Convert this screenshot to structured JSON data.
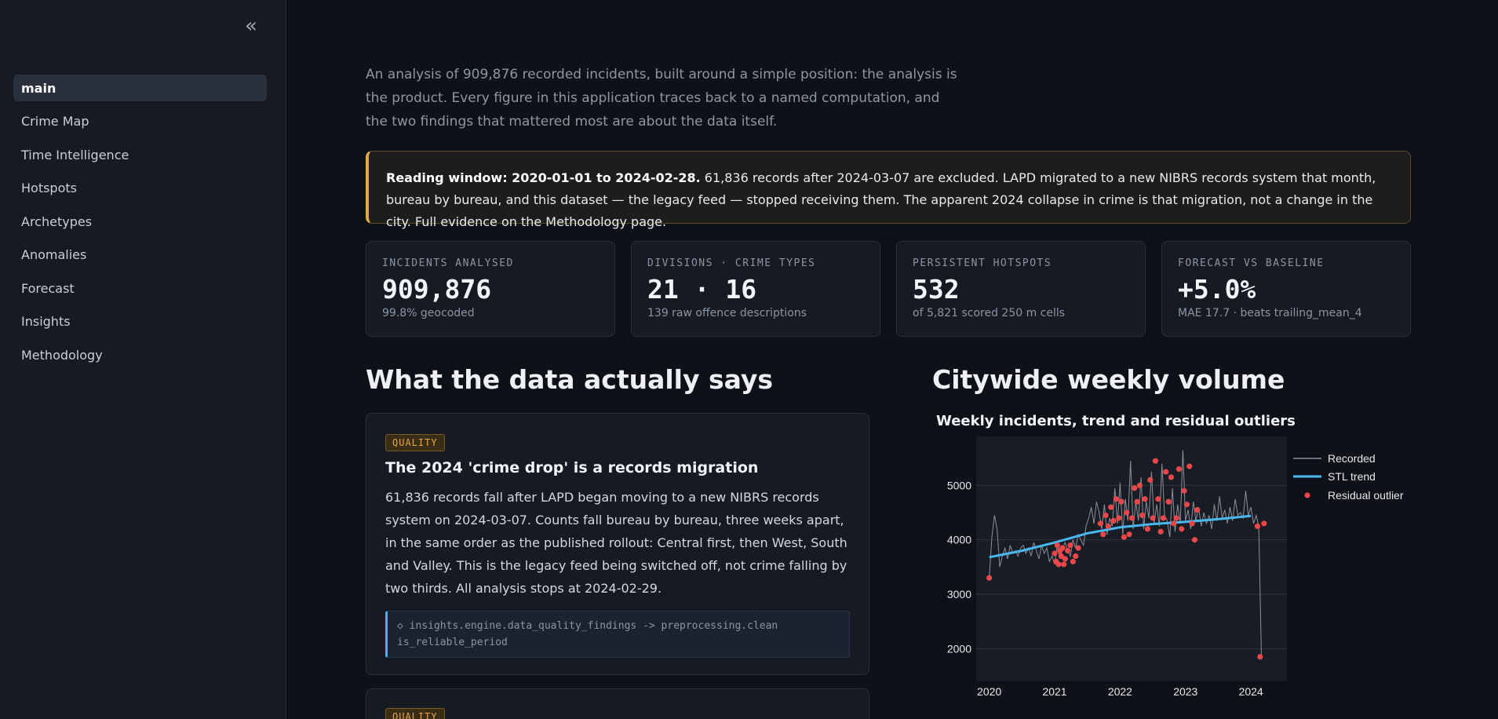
{
  "sidebar": {
    "collapse_icon": "«",
    "items": [
      {
        "label": "main",
        "active": true
      },
      {
        "label": "Crime Map"
      },
      {
        "label": "Time Intelligence"
      },
      {
        "label": "Hotspots"
      },
      {
        "label": "Archetypes"
      },
      {
        "label": "Anomalies"
      },
      {
        "label": "Forecast"
      },
      {
        "label": "Insights"
      },
      {
        "label": "Methodology"
      }
    ]
  },
  "intro": "An analysis of 909,876 recorded incidents, built around a simple position: the analysis is the product. Every figure in this application traces back to a named computation, and the two findings that mattered most are about the data itself.",
  "callout": {
    "bold": "Reading window: 2020-01-01 to 2024-02-28.",
    "text": " 61,836 records after 2024-03-07 are excluded. LAPD migrated to a new NIBRS records system that month, bureau by bureau, and this dataset — the legacy feed — stopped receiving them. The apparent 2024 collapse in crime is that migration, not a change in the city. Full evidence on the Methodology page."
  },
  "kpis": [
    {
      "label": "INCIDENTS ANALYSED",
      "value": "909,876",
      "sub": "99.8% geocoded"
    },
    {
      "label": "DIVISIONS · CRIME TYPES",
      "value": "21 · 16",
      "sub": "139 raw offence descriptions"
    },
    {
      "label": "PERSISTENT HOTSPOTS",
      "value": "532",
      "sub": "of 5,821 scored 250 m cells"
    },
    {
      "label": "FORECAST VS BASELINE",
      "value": "+5.0%",
      "sub": "MAE 17.7 · beats trailing_mean_4"
    }
  ],
  "findings": {
    "title": "What the data actually says",
    "cards": [
      {
        "tag": "QUALITY",
        "title": "The 2024 'crime drop' is a records migration",
        "body": "61,836 records fall after LAPD began moving to a new NIBRS records system on 2024-03-07. Counts fall bureau by bureau, three weeks apart, in the same order as the published rollout: Central first, then West, South and Valley. This is the legacy feed being switched off, not crime falling by two thirds. All analysis stops at 2024-02-29.",
        "code": "◇ insights.engine.data_quality_findings -> preprocessing.clean is_reliable_period"
      },
      {
        "tag": "QUALITY"
      }
    ]
  },
  "chart_section_title": "Citywide weekly volume",
  "colors": {
    "recorded": "#8a8f99",
    "trend": "#4ab8f0",
    "outlier": "#e8474a",
    "accent": "#e0a84a"
  },
  "chart_data": {
    "type": "line",
    "title": "Weekly incidents, trend and residual outliers",
    "xlabel": "",
    "ylabel": "",
    "xlim": [
      2019.8,
      2024.55
    ],
    "ylim": [
      1400,
      5900
    ],
    "xticks": [
      2020,
      2021,
      2022,
      2023,
      2024
    ],
    "yticks": [
      2000,
      3000,
      4000,
      5000
    ],
    "grid": true,
    "legend_position": "right",
    "series": [
      {
        "name": "Recorded",
        "x": [
          2020.0,
          2020.04,
          2020.08,
          2020.12,
          2020.16,
          2020.2,
          2020.24,
          2020.28,
          2020.32,
          2020.36,
          2020.4,
          2020.44,
          2020.48,
          2020.52,
          2020.56,
          2020.6,
          2020.64,
          2020.68,
          2020.72,
          2020.76,
          2020.8,
          2020.84,
          2020.88,
          2020.92,
          2020.96,
          2021.0,
          2021.04,
          2021.08,
          2021.12,
          2021.16,
          2021.2,
          2021.24,
          2021.28,
          2021.32,
          2021.36,
          2021.4,
          2021.44,
          2021.48,
          2021.52,
          2021.56,
          2021.6,
          2021.64,
          2021.68,
          2021.72,
          2021.76,
          2021.8,
          2021.84,
          2021.88,
          2021.92,
          2021.96,
          2022.0,
          2022.04,
          2022.08,
          2022.12,
          2022.16,
          2022.2,
          2022.24,
          2022.28,
          2022.32,
          2022.36,
          2022.4,
          2022.44,
          2022.48,
          2022.52,
          2022.56,
          2022.6,
          2022.64,
          2022.68,
          2022.72,
          2022.76,
          2022.8,
          2022.84,
          2022.88,
          2022.92,
          2022.96,
          2023.0,
          2023.04,
          2023.08,
          2023.12,
          2023.16,
          2023.2,
          2023.24,
          2023.28,
          2023.32,
          2023.36,
          2023.4,
          2023.44,
          2023.48,
          2023.52,
          2023.56,
          2023.6,
          2023.64,
          2023.68,
          2023.72,
          2023.76,
          2023.8,
          2023.84,
          2023.88,
          2023.92,
          2023.96,
          2024.0,
          2024.04,
          2024.08,
          2024.12,
          2024.16
        ],
        "y": [
          3300,
          4050,
          4450,
          4200,
          3500,
          3700,
          3850,
          3650,
          3900,
          3750,
          3800,
          3700,
          3850,
          3900,
          3750,
          3850,
          3700,
          3950,
          3800,
          3650,
          3900,
          3750,
          3850,
          3600,
          3700,
          3550,
          3900,
          3650,
          3850,
          3950,
          3800,
          3700,
          4000,
          3850,
          4100,
          4000,
          3900,
          4250,
          4400,
          4600,
          4300,
          4700,
          4500,
          4200,
          4650,
          4100,
          4400,
          4250,
          4950,
          4300,
          5050,
          4100,
          4750,
          4350,
          5450,
          4200,
          4700,
          4350,
          5150,
          4200,
          4700,
          4400,
          5250,
          4300,
          4650,
          4250,
          5400,
          4450,
          4350,
          4050,
          4950,
          4150,
          4650,
          4300,
          5650,
          4350,
          4550,
          4200,
          4700,
          4350,
          4600,
          4250,
          4500,
          4300,
          4450,
          4200,
          4650,
          4350,
          4800,
          4400,
          4550,
          4300,
          4600,
          4350,
          4750,
          4450,
          4500,
          4400,
          4900,
          4450,
          4600,
          4300,
          4450,
          4250,
          1850
        ]
      },
      {
        "name": "STL trend",
        "x": [
          2020.0,
          2020.5,
          2021.0,
          2021.5,
          2022.0,
          2022.5,
          2023.0,
          2023.5,
          2024.0
        ],
        "y": [
          3680,
          3800,
          3950,
          4120,
          4230,
          4290,
          4330,
          4380,
          4440
        ]
      },
      {
        "name": "Residual outlier",
        "x": [
          2020.0,
          2021.0,
          2021.02,
          2021.04,
          2021.06,
          2021.08,
          2021.1,
          2021.12,
          2021.14,
          2021.16,
          2021.2,
          2021.24,
          2021.28,
          2021.32,
          2021.36,
          2021.7,
          2021.74,
          2021.78,
          2021.82,
          2021.86,
          2021.9,
          2021.94,
          2021.98,
          2022.02,
          2022.06,
          2022.1,
          2022.14,
          2022.18,
          2022.22,
          2022.26,
          2022.3,
          2022.34,
          2022.38,
          2022.42,
          2022.46,
          2022.5,
          2022.54,
          2022.58,
          2022.62,
          2022.66,
          2022.7,
          2022.74,
          2022.78,
          2022.82,
          2022.86,
          2022.9,
          2022.94,
          2022.98,
          2023.02,
          2023.06,
          2023.1,
          2023.14,
          2023.18,
          2024.1,
          2024.14,
          2024.2
        ],
        "y": [
          3300,
          3750,
          3600,
          3900,
          3550,
          3800,
          3700,
          3850,
          3550,
          3650,
          3800,
          3900,
          3600,
          3700,
          3850,
          4300,
          4100,
          4450,
          4250,
          4600,
          4350,
          4750,
          4400,
          4700,
          4050,
          4500,
          4100,
          4400,
          4950,
          4700,
          5000,
          4450,
          4750,
          4200,
          5100,
          4400,
          5450,
          4750,
          4150,
          4400,
          5250,
          4700,
          5150,
          4300,
          4400,
          5300,
          4200,
          4900,
          4650,
          5350,
          4300,
          4000,
          4550,
          4250,
          1850,
          4300
        ]
      }
    ]
  }
}
